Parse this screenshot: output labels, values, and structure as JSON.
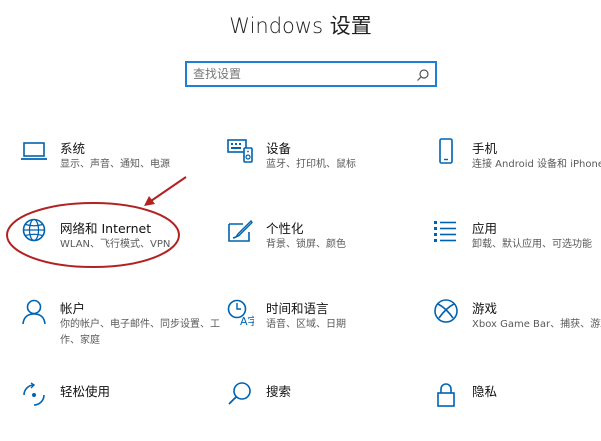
{
  "header": {
    "title": "Windows 设置"
  },
  "search": {
    "placeholder": "查找设置"
  },
  "settings": [
    {
      "name": "系统",
      "desc": "显示、声音、通知、电源",
      "icon": "laptop-icon"
    },
    {
      "name": "设备",
      "desc": "蓝牙、打印机、鼠标",
      "icon": "keyboard-icon"
    },
    {
      "name": "手机",
      "desc": "连接 Android 设备和 iPhone",
      "icon": "phone-icon"
    },
    {
      "name": "网络和 Internet",
      "desc": "WLAN、飞行模式、VPN",
      "icon": "globe-icon"
    },
    {
      "name": "个性化",
      "desc": "背景、锁屏、颜色",
      "icon": "paint-icon"
    },
    {
      "name": "应用",
      "desc": "卸载、默认应用、可选功能",
      "icon": "apps-list-icon"
    },
    {
      "name": "帐户",
      "desc": "你的帐户、电子邮件、同步设置、工作、家庭",
      "icon": "person-icon"
    },
    {
      "name": "时间和语言",
      "desc": "语音、区域、日期",
      "icon": "time-language-icon"
    },
    {
      "name": "游戏",
      "desc": "Xbox Game Bar、捕获、游戏模式",
      "icon": "xbox-icon"
    },
    {
      "name": "轻松使用",
      "desc": "",
      "icon": "ease-of-access-icon"
    },
    {
      "name": "搜索",
      "desc": "",
      "icon": "search-icon"
    },
    {
      "name": "隐私",
      "desc": "",
      "icon": "lock-icon"
    }
  ],
  "colors": {
    "accent": "#0063b1",
    "search_border": "#1f7ed6",
    "annotation": "#b22222"
  }
}
